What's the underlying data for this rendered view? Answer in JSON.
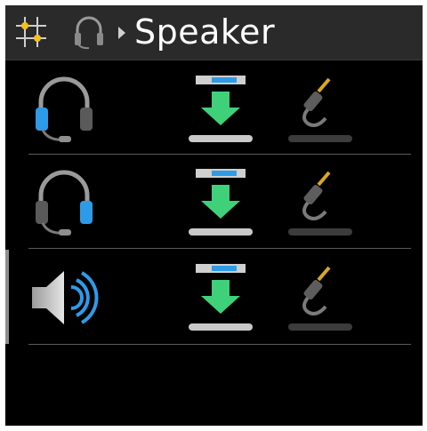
{
  "header": {
    "title": "Speaker",
    "icons": [
      "settings-grid-icon",
      "headset-icon",
      "breadcrumb-arrow-icon"
    ]
  },
  "rows": [
    {
      "device": "headset-left-icon",
      "route_icon": "route-down-arrow-icon",
      "output_icon": "audio-jack-icon",
      "selected": false
    },
    {
      "device": "headset-right-icon",
      "route_icon": "route-down-arrow-icon",
      "output_icon": "audio-jack-icon",
      "selected": false
    },
    {
      "device": "speaker-icon",
      "route_icon": "route-down-arrow-icon",
      "output_icon": "audio-jack-icon",
      "selected": true
    }
  ],
  "colors": {
    "background": "#000000",
    "header": "#2a2a2a",
    "accent_green": "#3fd17a",
    "accent_blue": "#2f8fe0",
    "jack_gold": "#d9a823"
  }
}
